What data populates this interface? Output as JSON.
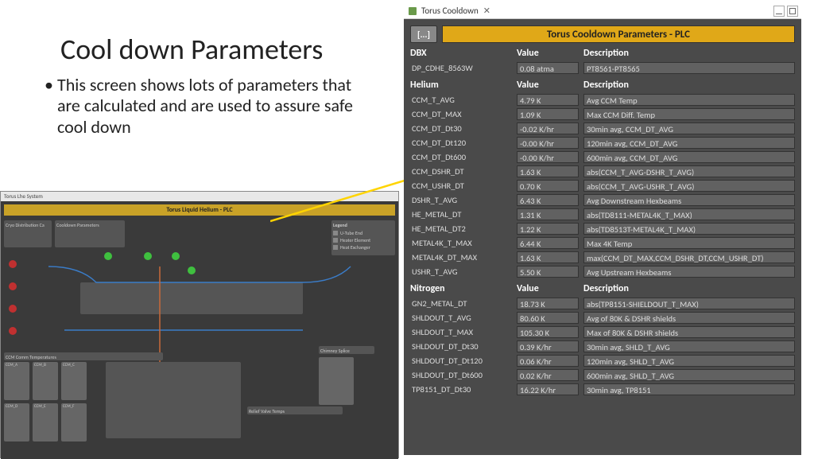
{
  "slide": {
    "title": "Cool down Parameters",
    "bullet1": "This screen shows lots of parameters that are calculated and are used to assure safe cool down"
  },
  "thumb": {
    "tab": "Torus Lhe System",
    "goldTitle": "Torus Liquid Helium - PLC",
    "cooldownLabel": "Cooldown Parameters",
    "legendTitle": "Legend",
    "legend1": "U-Tube End",
    "legend2": "Heater Element",
    "legend3": "Heat Exchanger",
    "ccmTitle": "CCM Comm Temperatures",
    "ccmA": "CCM_A",
    "ccmB": "CCM_B",
    "ccmC": "CCM_C",
    "ccmD": "CCM_D",
    "ccmE": "CCM_E",
    "ccmF": "CCM_F",
    "reliefTitle": "Relief Valve Temps",
    "chimneyTitle": "Chimney Splice",
    "dbxTitle": "Cryo Distribution Ca"
  },
  "panel": {
    "tabTitle": "Torus Cooldown",
    "btn": "[...]",
    "goldTitle": "Torus Cooldown Parameters - PLC"
  },
  "sections": [
    {
      "title": "DBX",
      "valueLabel": "Value",
      "descLabel": "Description",
      "rows": [
        {
          "name": "DP_CDHE_8563W",
          "value": "0.08 atma",
          "desc": "PT8561-PT8565"
        }
      ]
    },
    {
      "title": "Helium",
      "valueLabel": "Value",
      "descLabel": "Description",
      "rows": [
        {
          "name": "CCM_T_AVG",
          "value": "4.79 K",
          "desc": "Avg CCM Temp"
        },
        {
          "name": "CCM_DT_MAX",
          "value": "1.09 K",
          "desc": "Max CCM Diff. Temp"
        },
        {
          "name": "CCM_DT_Dt30",
          "value": "-0.02 K/hr",
          "desc": "30min avg, CCM_DT_AVG"
        },
        {
          "name": "CCM_DT_Dt120",
          "value": "-0.00 K/hr",
          "desc": "120min avg, CCM_DT_AVG"
        },
        {
          "name": "CCM_DT_Dt600",
          "value": "-0.00 K/hr",
          "desc": "600min avg, CCM_DT_AVG"
        },
        {
          "name": "CCM_DSHR_DT",
          "value": "1.63 K",
          "desc": "abs(CCM_T_AVG-DSHR_T_AVG)"
        },
        {
          "name": "CCM_USHR_DT",
          "value": "0.70 K",
          "desc": "abs(CCM_T_AVG-USHR_T_AVG)"
        },
        {
          "name": "DSHR_T_AVG",
          "value": "6.43 K",
          "desc": "Avg Downstream Hexbeams"
        },
        {
          "name": "HE_METAL_DT",
          "value": "1.31 K",
          "desc": "abs(TD8111-METAL4K_T_MAX)"
        },
        {
          "name": "HE_METAL_DT2",
          "value": "1.22 K",
          "desc": "abs(TD8513T-METAL4K_T_MAX)"
        },
        {
          "name": "METAL4K_T_MAX",
          "value": "6.44 K",
          "desc": "Max 4K Temp"
        },
        {
          "name": "METAL4K_DT_MAX",
          "value": "1.63 K",
          "desc": "max(CCM_DT_MAX,CCM_DSHR_DT,CCM_USHR_DT)"
        },
        {
          "name": "USHR_T_AVG",
          "value": "5.50 K",
          "desc": "Avg Upstream Hexbeams"
        }
      ]
    },
    {
      "title": "Nitrogen",
      "valueLabel": "Value",
      "descLabel": "Description",
      "rows": [
        {
          "name": "GN2_METAL_DT",
          "value": "18.73 K",
          "desc": "abs(TP8151-SHIELDOUT_T_MAX)"
        },
        {
          "name": "SHLDOUT_T_AVG",
          "value": "80.60 K",
          "desc": "Avg of 80K & DSHR shields"
        },
        {
          "name": "SHLDOUT_T_MAX",
          "value": "105.30 K",
          "desc": "Max of 80K & DSHR shields"
        },
        {
          "name": "SHLDOUT_DT_Dt30",
          "value": "0.39 K/hr",
          "desc": "30min avg, SHLD_T_AVG"
        },
        {
          "name": "SHLDOUT_DT_Dt120",
          "value": "0.06 K/hr",
          "desc": "120min avg, SHLD_T_AVG"
        },
        {
          "name": "SHLDOUT_DT_Dt600",
          "value": "0.02 K/hr",
          "desc": "600min avg, SHLD_T_AVG"
        },
        {
          "name": "TP8151_DT_Dt30",
          "value": "16.22 K/hr",
          "desc": "30min avg, TP8151"
        }
      ]
    }
  ]
}
